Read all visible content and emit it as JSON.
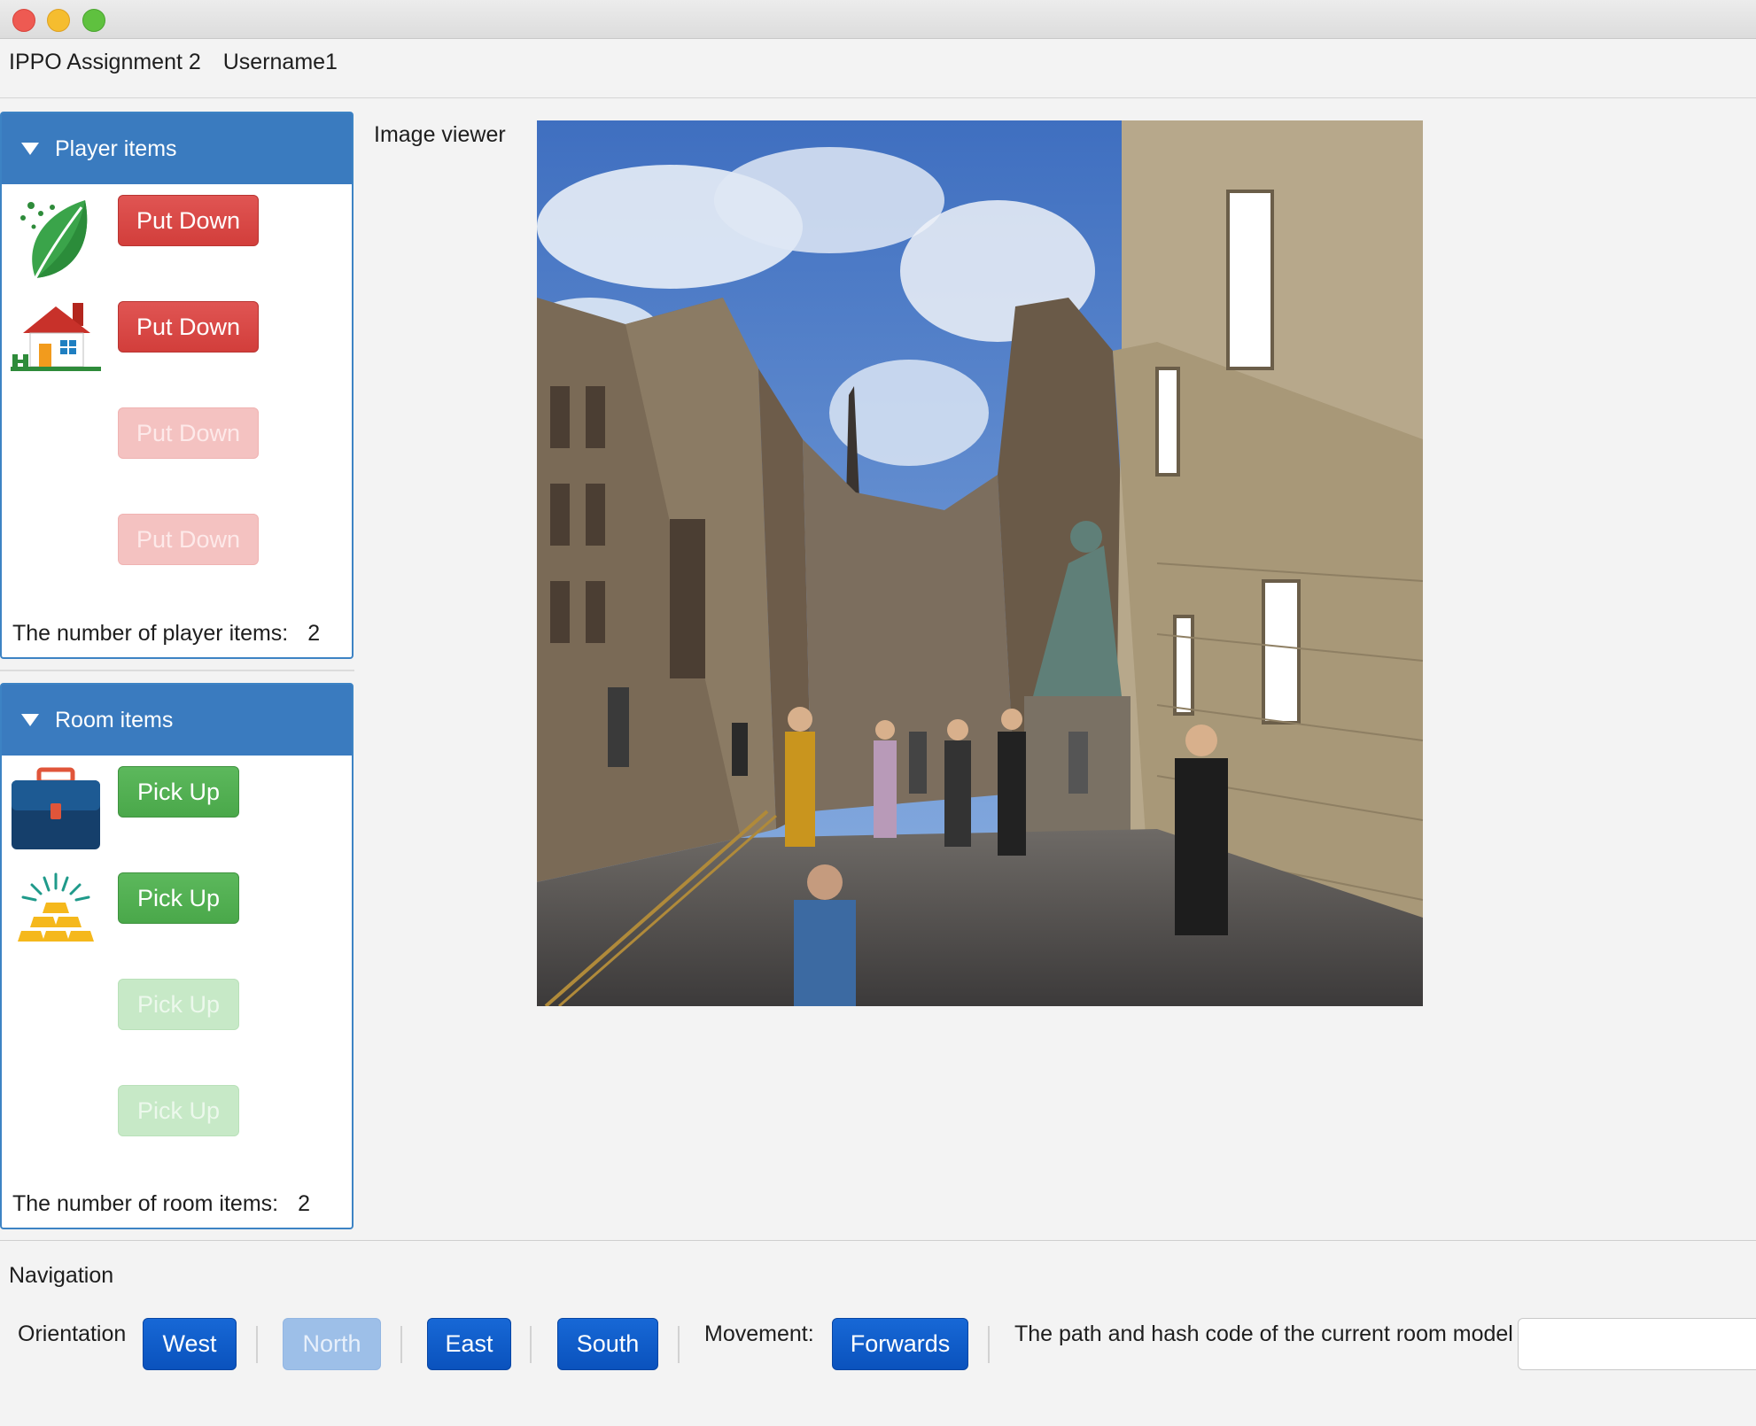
{
  "window": {
    "title": "IPPO Assignment 2",
    "username": "Username1"
  },
  "player_panel": {
    "header": "Player items",
    "items": [
      {
        "icon": "leaf-icon",
        "button": "Put Down",
        "enabled": true
      },
      {
        "icon": "house-icon",
        "button": "Put Down",
        "enabled": true
      },
      {
        "icon": "",
        "button": "Put Down",
        "enabled": false
      },
      {
        "icon": "",
        "button": "Put Down",
        "enabled": false
      }
    ],
    "count_label": "The number of player items:",
    "count": "2"
  },
  "room_panel": {
    "header": "Room items",
    "items": [
      {
        "icon": "briefcase-icon",
        "button": "Pick Up",
        "enabled": true
      },
      {
        "icon": "gold-bars-icon",
        "button": "Pick Up",
        "enabled": true
      },
      {
        "icon": "",
        "button": "Pick Up",
        "enabled": false
      },
      {
        "icon": "",
        "button": "Pick Up",
        "enabled": false
      }
    ],
    "count_label": "The number of room items:",
    "count": "2"
  },
  "image_viewer": {
    "label": "Image viewer"
  },
  "navigation": {
    "title": "Navigation",
    "orientation_label": "Orientation",
    "west": "West",
    "north": "North",
    "east": "East",
    "south": "South",
    "movement_label": "Movement:",
    "forwards": "Forwards",
    "hash_label": "The path and hash code of the current room model",
    "hash_value": ""
  },
  "colors": {
    "panel_header": "#3a7bbf",
    "put_down": "#d23e3b",
    "pick_up": "#4aa84a",
    "nav_button": "#0a52bd"
  }
}
